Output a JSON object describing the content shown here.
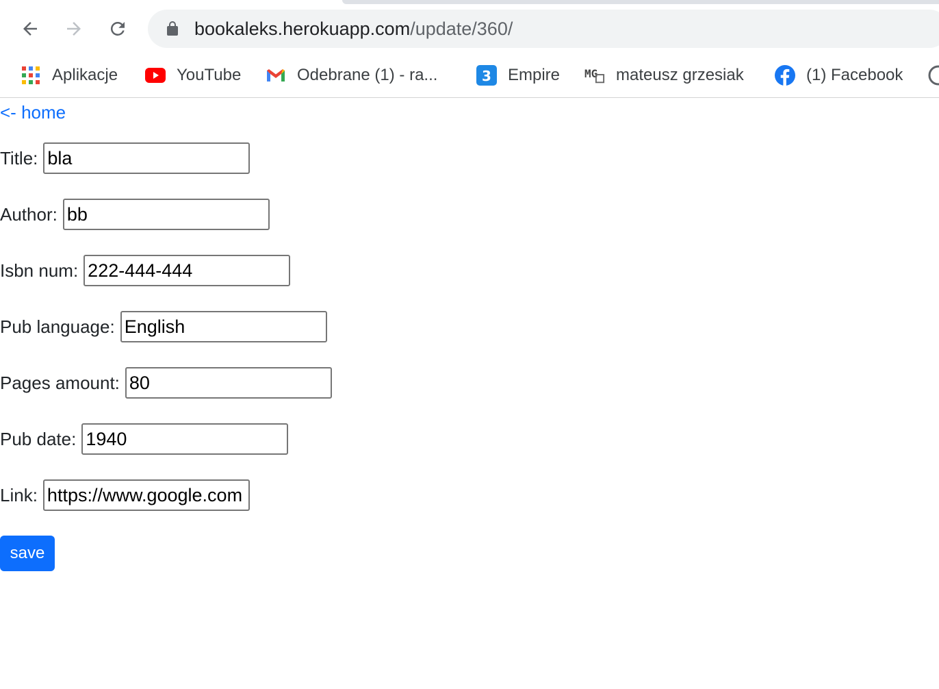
{
  "browser": {
    "url_host": "bookaleks.herokuapp.com",
    "url_path": "/update/360/",
    "bookmarks": [
      {
        "label": "Aplikacje",
        "icon": "apps-grid-icon"
      },
      {
        "label": "YouTube",
        "icon": "youtube-icon"
      },
      {
        "label": "Odebrane (1) - ra...",
        "icon": "gmail-icon"
      },
      {
        "label": "Empire",
        "icon": "empire-icon"
      },
      {
        "label": "mateusz grzesiak",
        "icon": "mg-icon"
      },
      {
        "label": "(1) Facebook",
        "icon": "facebook-icon"
      }
    ]
  },
  "page": {
    "home_link": "<- home",
    "fields": [
      {
        "label": "Title:",
        "value": "bla"
      },
      {
        "label": "Author:",
        "value": "bb"
      },
      {
        "label": "Isbn num:",
        "value": "222-444-444"
      },
      {
        "label": "Pub language:",
        "value": "English"
      },
      {
        "label": "Pages amount:",
        "value": "80"
      },
      {
        "label": "Pub date:",
        "value": "1940"
      },
      {
        "label": "Link:",
        "value": "https://www.google.com"
      }
    ],
    "save_label": "save"
  },
  "colors": {
    "link": "#0d6efd",
    "button_bg": "#0d6efd",
    "omnibox_bg": "#f1f3f4"
  }
}
